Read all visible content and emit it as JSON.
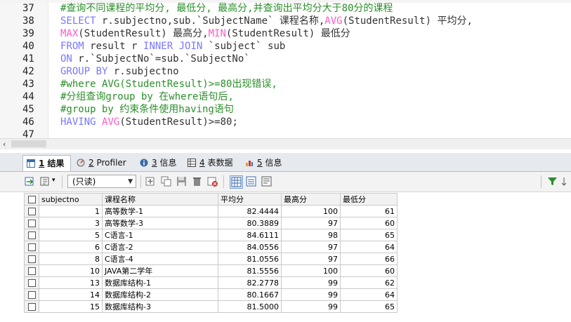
{
  "editor": {
    "lines": [
      {
        "num": "37",
        "tokens": [
          {
            "t": "#查询不同课程的平均分, 最低分, 最高分,并查询出平均分大于80分的课程",
            "c": "cm"
          }
        ]
      },
      {
        "num": "38",
        "tokens": [
          {
            "t": "SELECT",
            "c": "kw"
          },
          {
            "t": " r.subjectno,sub.`SubjectName` 课程名称,",
            "c": "id"
          },
          {
            "t": "AVG",
            "c": "fn"
          },
          {
            "t": "(StudentResult) 平均分,",
            "c": "id"
          }
        ]
      },
      {
        "num": "39",
        "tokens": [
          {
            "t": "MAX",
            "c": "fn"
          },
          {
            "t": "(StudentResult) 最高分,",
            "c": "id"
          },
          {
            "t": "MIN",
            "c": "fn"
          },
          {
            "t": "(StudentResult) 最低分",
            "c": "id"
          }
        ]
      },
      {
        "num": "40",
        "tokens": [
          {
            "t": "FROM",
            "c": "kw"
          },
          {
            "t": " result r ",
            "c": "id"
          },
          {
            "t": "INNER JOIN",
            "c": "kw"
          },
          {
            "t": " `subject` sub",
            "c": "id"
          }
        ]
      },
      {
        "num": "41",
        "tokens": [
          {
            "t": "ON",
            "c": "kw"
          },
          {
            "t": " r.`SubjectNo`=sub.`SubjectNo`",
            "c": "id"
          }
        ]
      },
      {
        "num": "42",
        "tokens": [
          {
            "t": "GROUP BY",
            "c": "kw"
          },
          {
            "t": " r.subjectno",
            "c": "id"
          }
        ]
      },
      {
        "num": "43",
        "tokens": [
          {
            "t": "#where AVG(StudentResult)>=80出现错误,",
            "c": "cm"
          }
        ]
      },
      {
        "num": "44",
        "tokens": [
          {
            "t": "#分组查询group by 在where语句后,",
            "c": "cm"
          }
        ]
      },
      {
        "num": "45",
        "tokens": [
          {
            "t": "#group by 约束条件使用having语句",
            "c": "cm"
          }
        ]
      },
      {
        "num": "46",
        "tokens": [
          {
            "t": "HAVING",
            "c": "kw"
          },
          {
            "t": " ",
            "c": "id"
          },
          {
            "t": "AVG",
            "c": "fn"
          },
          {
            "t": "(StudentResult)>=80;",
            "c": "id"
          }
        ]
      },
      {
        "num": "47",
        "tokens": []
      }
    ]
  },
  "tabs": [
    {
      "num": "1",
      "label": "结果",
      "icon": "result-grid-icon"
    },
    {
      "num": "2",
      "label": "Profiler",
      "icon": "profiler-icon"
    },
    {
      "num": "3",
      "label": "信息",
      "icon": "info-icon"
    },
    {
      "num": "4",
      "label": "表数据",
      "icon": "table-data-icon"
    },
    {
      "num": "5",
      "label": "信息",
      "icon": "info-chart-icon"
    }
  ],
  "toolbar": {
    "mode_select": "(只读)"
  },
  "grid": {
    "columns": [
      "subjectno",
      "课程名称",
      "平均分",
      "最高分",
      "最低分"
    ],
    "rows": [
      [
        "1",
        "高等数学-1",
        "82.4444",
        "100",
        "61"
      ],
      [
        "3",
        "高等数学-3",
        "80.3889",
        "97",
        "60"
      ],
      [
        "5",
        "C语言-1",
        "84.6111",
        "98",
        "65"
      ],
      [
        "6",
        "C语言-2",
        "84.0556",
        "97",
        "64"
      ],
      [
        "8",
        "C语言-4",
        "81.0556",
        "97",
        "66"
      ],
      [
        "10",
        "JAVA第二学年",
        "81.5556",
        "100",
        "60"
      ],
      [
        "13",
        "数据库结构-1",
        "82.2778",
        "99",
        "62"
      ],
      [
        "14",
        "数据库结构-2",
        "80.1667",
        "99",
        "64"
      ],
      [
        "15",
        "数据库结构-3",
        "81.5000",
        "99",
        "65"
      ]
    ]
  },
  "colors": {
    "keyword": "#7777ff",
    "function": "#ff5ac8",
    "comment": "#2a8f2a"
  }
}
